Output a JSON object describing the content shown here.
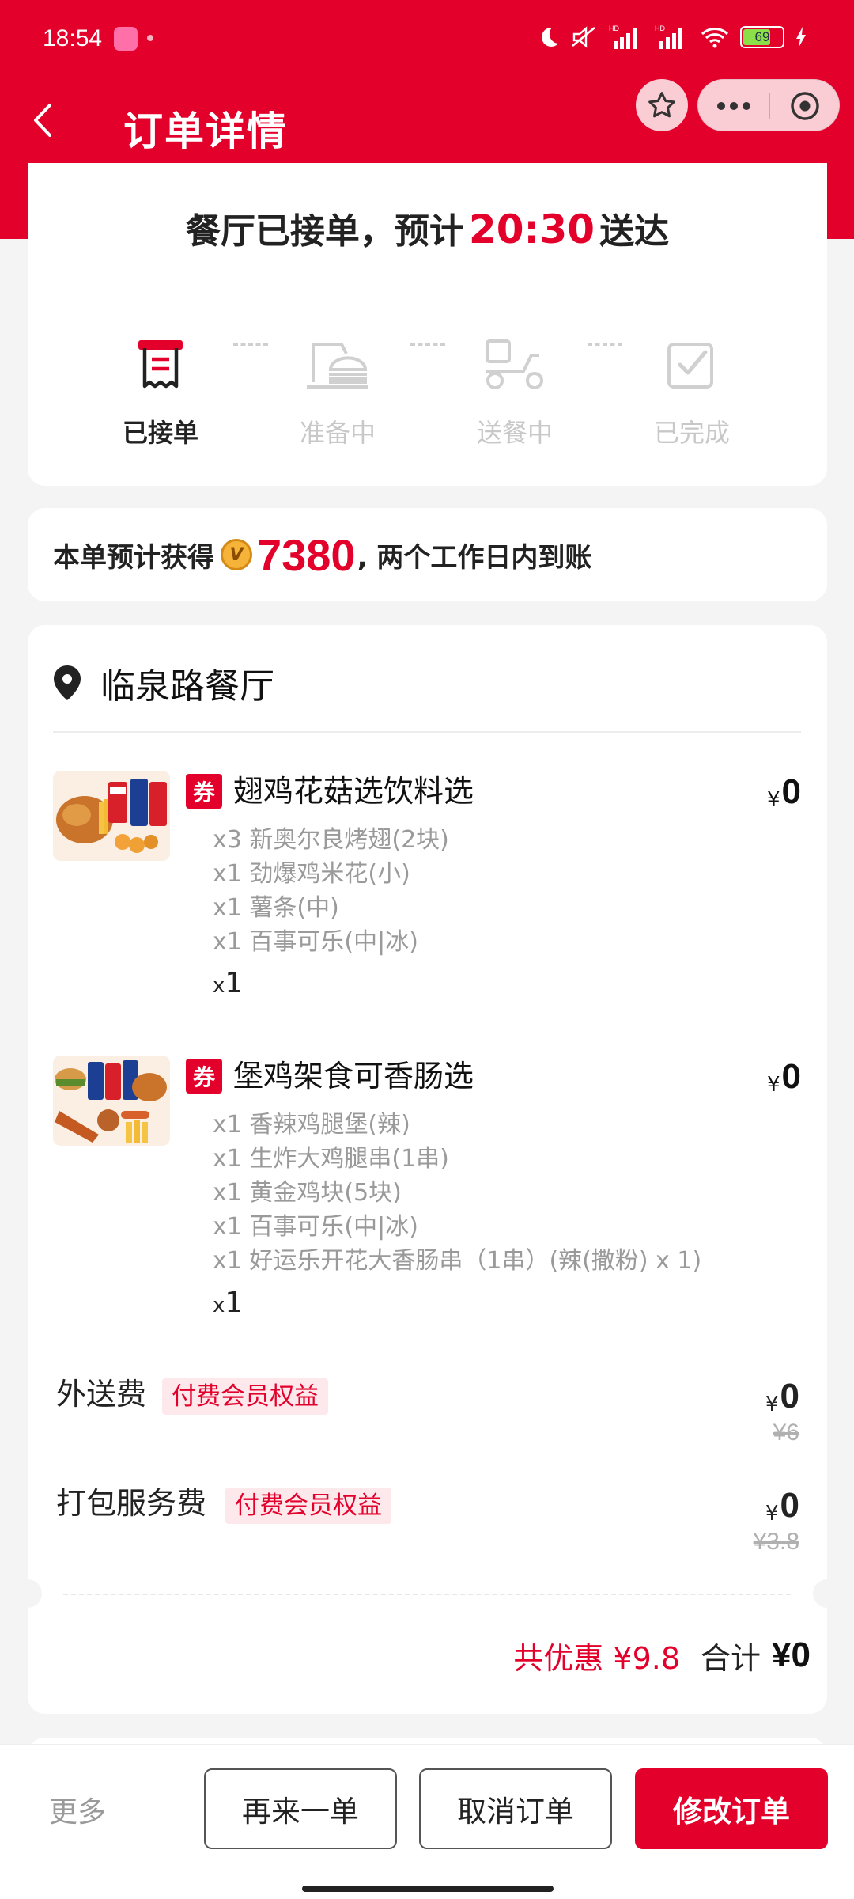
{
  "status_bar": {
    "time": "18:54",
    "battery": "69",
    "network_1": "HD",
    "network_2": "HD"
  },
  "nav": {
    "title": "订单详情"
  },
  "status": {
    "prefix": "餐厅已接单，预计",
    "eta": "20:30",
    "suffix": "送达",
    "steps": [
      {
        "label": "已接单",
        "icon": "receipt-icon",
        "active": true
      },
      {
        "label": "准备中",
        "icon": "burger-icon",
        "active": false
      },
      {
        "label": "送餐中",
        "icon": "scooter-icon",
        "active": false
      },
      {
        "label": "已完成",
        "icon": "check-box-icon",
        "active": false
      }
    ]
  },
  "points": {
    "prefix": "本单预计获得",
    "amount": "7380",
    "suffix": ", 两个工作日内到账"
  },
  "order": {
    "restaurant": "临泉路餐厅",
    "items": [
      {
        "coupon": "券",
        "name": "翅鸡花菇选饮料选",
        "currency": "¥",
        "price": "0",
        "subs": [
          "x3 新奥尔良烤翅(2块)",
          "x1 劲爆鸡米花(小)",
          "x1 薯条(中)",
          "x1 百事可乐(中|冰)"
        ],
        "qty_prefix": "x",
        "qty": "1"
      },
      {
        "coupon": "券",
        "name": "堡鸡架食可香肠选",
        "currency": "¥",
        "price": "0",
        "subs": [
          "x1 香辣鸡腿堡(辣)",
          "x1 生炸大鸡腿串(1串)",
          "x1 黄金鸡块(5块)",
          "x1 百事可乐(中|冰)",
          "x1 好运乐开花大香肠串（1串）(辣(撒粉) x 1)"
        ],
        "qty_prefix": "x",
        "qty": "1"
      }
    ],
    "fees": [
      {
        "label": "外送费",
        "tag": "付费会员权益",
        "currency": "¥",
        "price": "0",
        "original": "¥6"
      },
      {
        "label": "打包服务费",
        "tag": "付费会员权益",
        "currency": "¥",
        "price": "0",
        "original": "¥3.8"
      }
    ],
    "discount_text": "共优惠 ¥9.8",
    "total_label": "合计",
    "total_amount": "¥0"
  },
  "bottom": {
    "more": "更多",
    "reorder": "再来一单",
    "cancel": "取消订单",
    "modify": "修改订单"
  },
  "colors": {
    "brand_red": "#e3002b",
    "muted_text": "#9a9a9a",
    "tag_bg": "#fde8ec"
  }
}
